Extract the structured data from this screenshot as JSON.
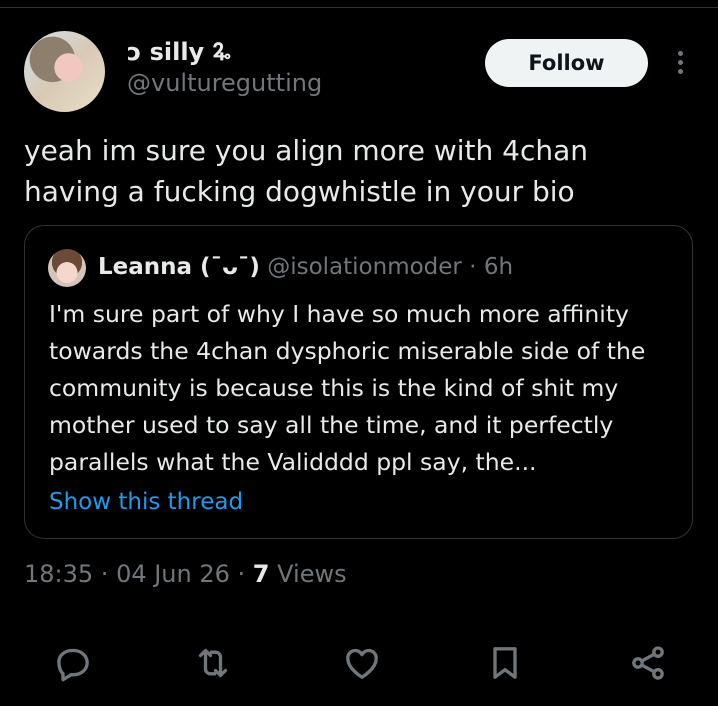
{
  "post": {
    "display_name": "ͻ silly 🜩",
    "handle": "@vulturegutting",
    "follow_label": "Follow",
    "text": "yeah im sure you align more with 4chan having a fucking dogwhistle in your bio"
  },
  "quote": {
    "name": "Leanna (¯ᴗ¯)",
    "handle": "@isolationmoder",
    "separator": " · ",
    "age": "6h",
    "text": "I'm sure part of why I have so much more affinity towards the 4chan dysphoric miserable side of the community is because this is the kind of shit my mother used to say all the time, and it perfectly parallels what the Validddd ppl say, the...",
    "show_thread": "Show this thread"
  },
  "meta": {
    "time": "18:35",
    "dot": " · ",
    "date": "04 Jun 26",
    "views_count": "7",
    "views_label": " Views"
  },
  "actions": {
    "icons": [
      "reply-icon",
      "repost-icon",
      "like-icon",
      "bookmark-icon",
      "share-icon"
    ],
    "icon_color": "#71767b"
  },
  "colors": {
    "background": "#000000",
    "text": "#e7e9ea",
    "muted": "#71767b",
    "link": "#1d9bf0",
    "border": "#2f3336"
  }
}
